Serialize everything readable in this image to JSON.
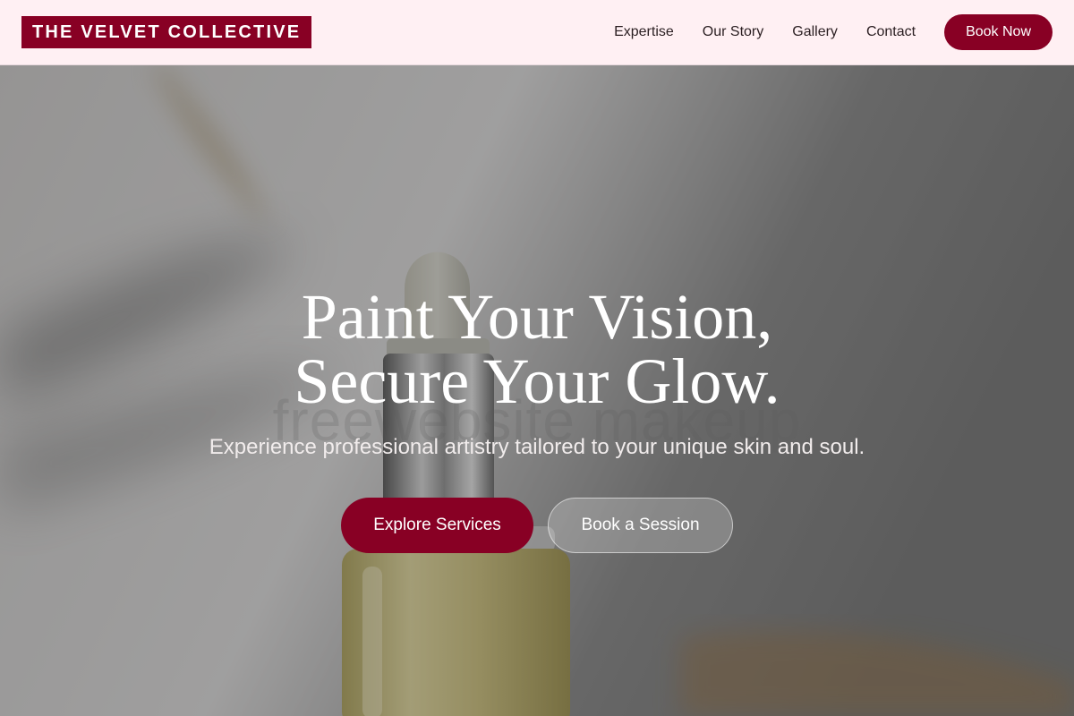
{
  "brand": {
    "name": "THE VELVET COLLECTIVE",
    "accent_color": "#880024"
  },
  "nav": {
    "links": [
      "Expertise",
      "Our Story",
      "Gallery",
      "Contact"
    ],
    "cta_label": "Book Now"
  },
  "hero": {
    "title_line1": "Paint Your Vision,",
    "title_line2": "Secure Your Glow.",
    "subtitle": "Experience professional artistry tailored to your unique skin and soul.",
    "primary_button": "Explore Services",
    "secondary_button": "Book a Session",
    "watermark": "freewebsite makeup",
    "background_image": "serum-dropper-bottle-photo"
  }
}
